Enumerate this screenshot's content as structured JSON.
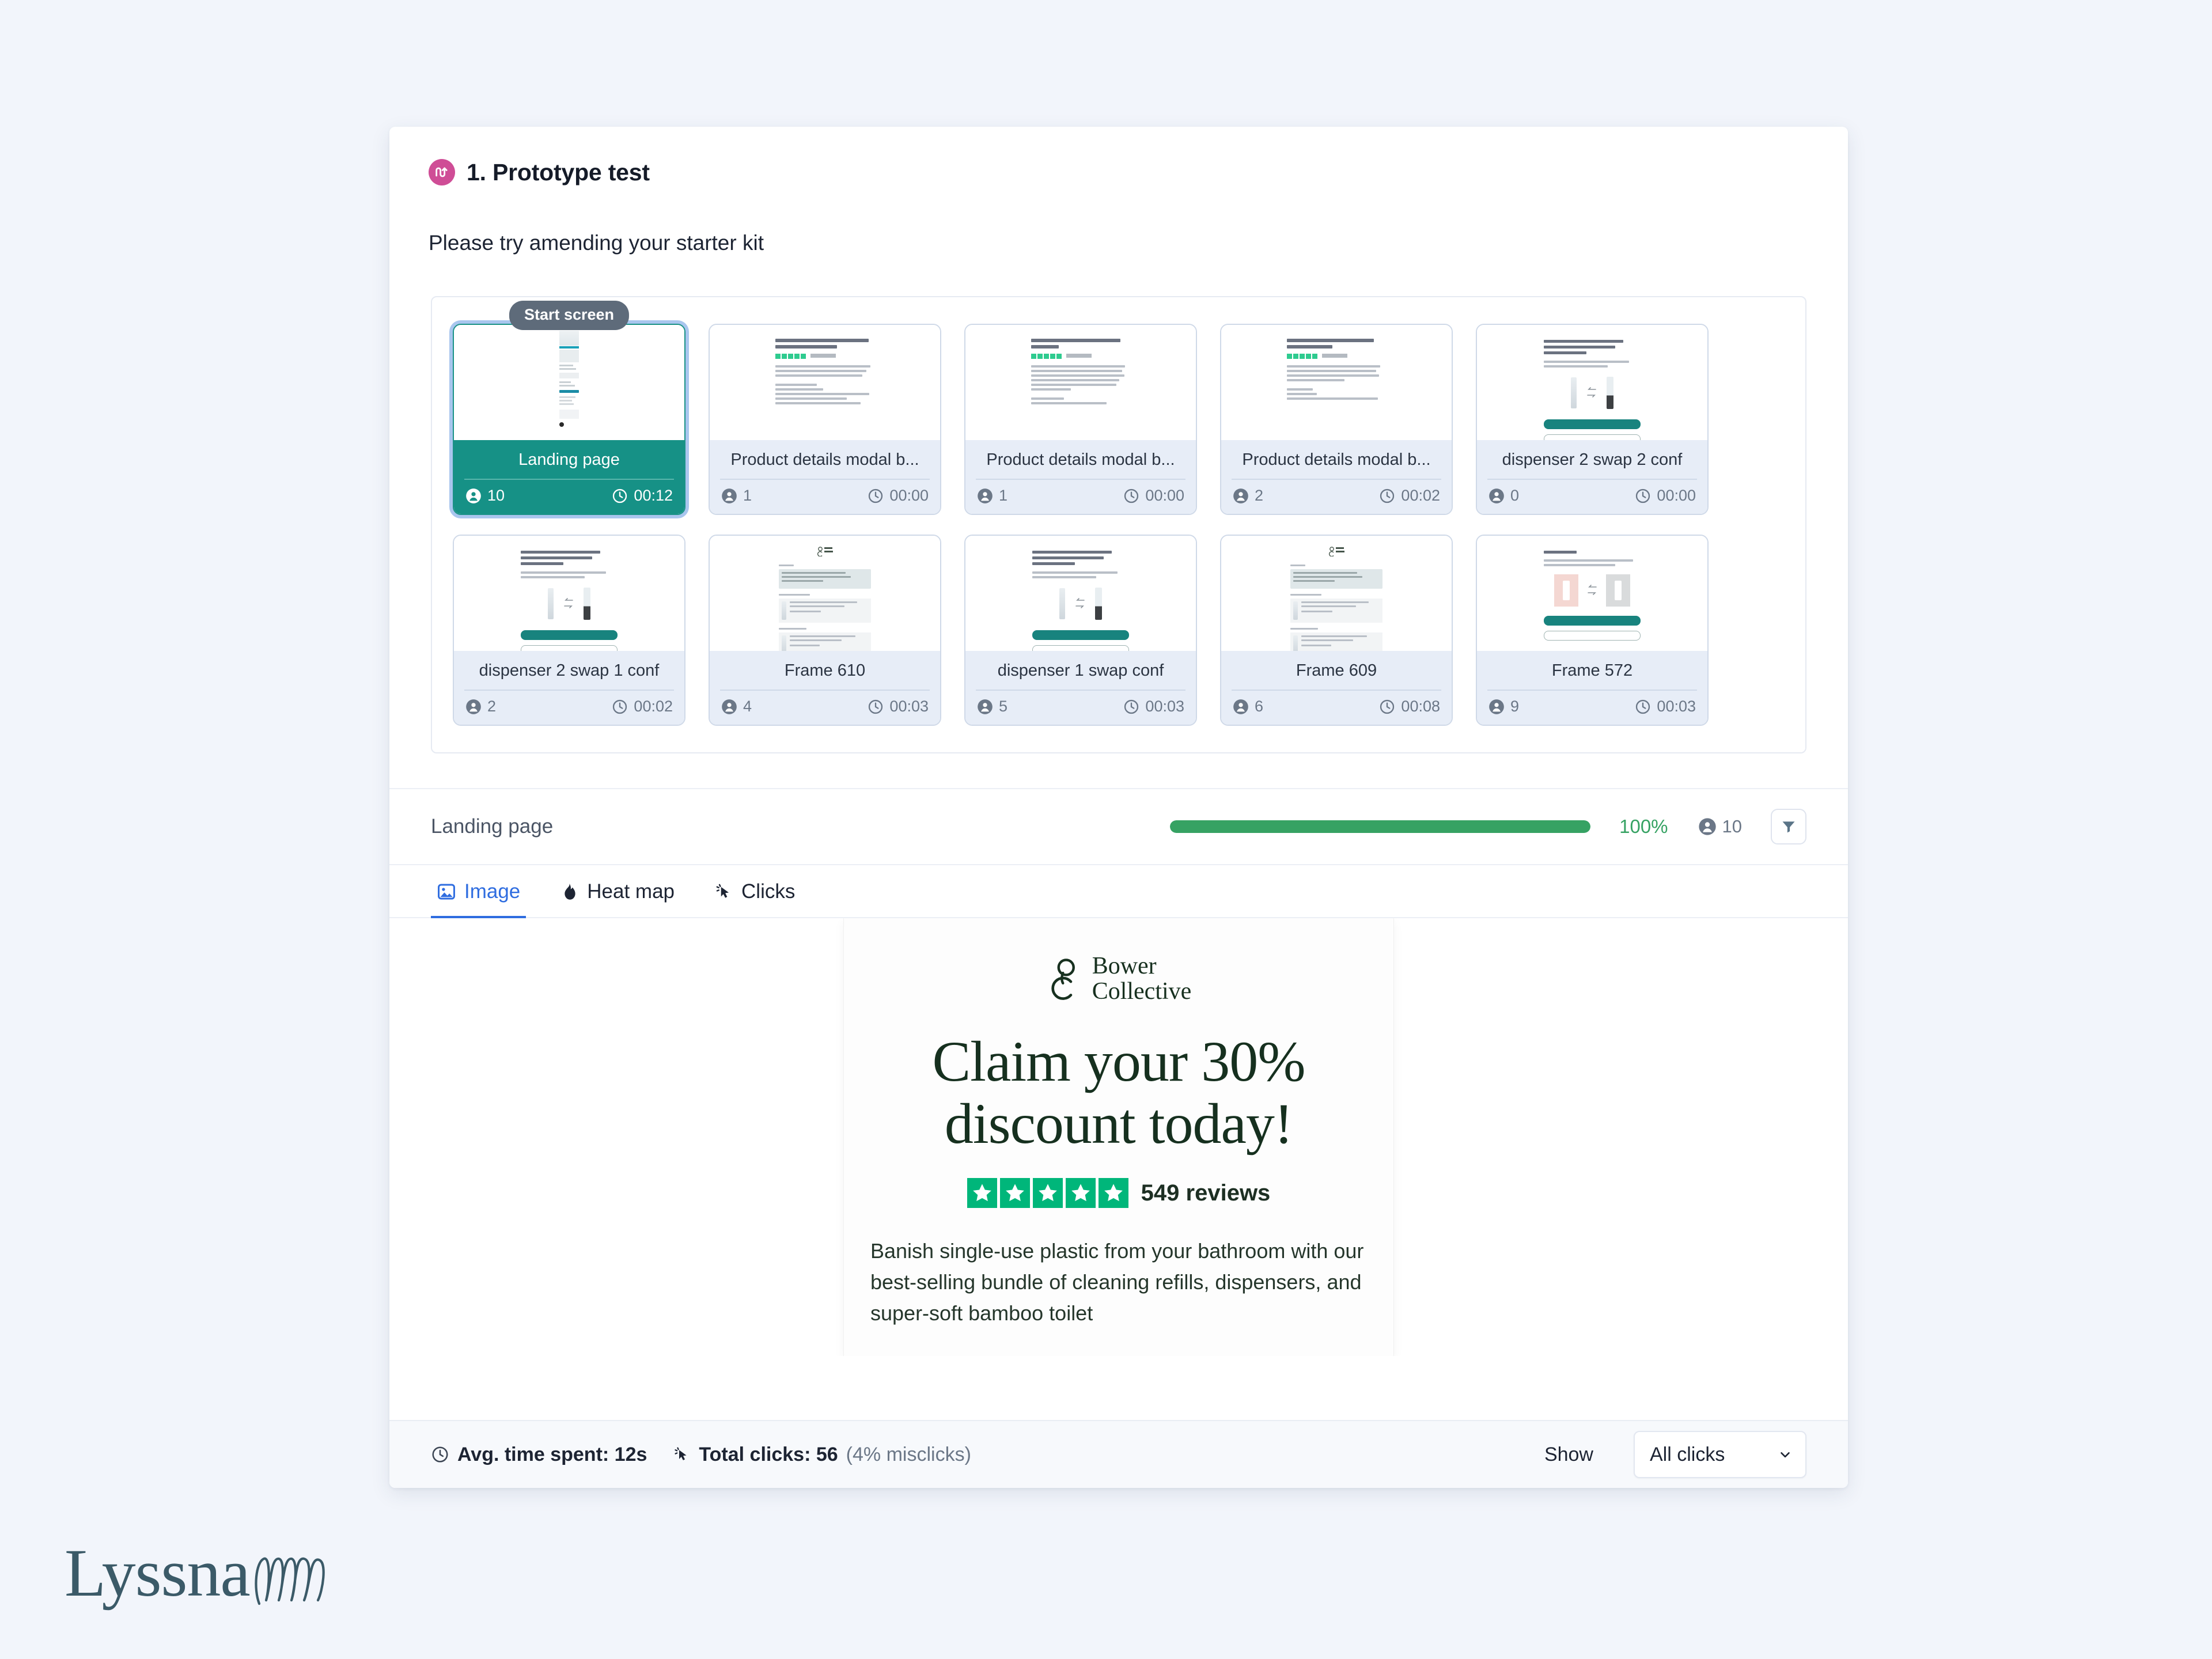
{
  "background_color": "#f2f5fb",
  "header": {
    "badge_icon": "prototype-flow-icon",
    "badge_color": "#cf4d96",
    "title": "1. Prototype test",
    "task_text": "Please try amending your starter kit"
  },
  "screens": {
    "start_pill_label": "Start screen",
    "items": [
      {
        "name": "Landing page",
        "participants": "10",
        "time": "00:12",
        "selected": true,
        "mock": "landing"
      },
      {
        "name": "Product details modal b...",
        "participants": "1",
        "time": "00:00",
        "selected": false,
        "mock": "product1"
      },
      {
        "name": "Product details modal b...",
        "participants": "1",
        "time": "00:00",
        "selected": false,
        "mock": "product2"
      },
      {
        "name": "Product details modal b...",
        "participants": "2",
        "time": "00:02",
        "selected": false,
        "mock": "product3"
      },
      {
        "name": "dispenser 2 swap 2 conf",
        "participants": "0",
        "time": "00:00",
        "selected": false,
        "mock": "swap"
      },
      {
        "name": "dispenser 2 swap 1 conf",
        "participants": "2",
        "time": "00:02",
        "selected": false,
        "mock": "swap"
      },
      {
        "name": "Frame 610",
        "participants": "4",
        "time": "00:03",
        "selected": false,
        "mock": "frame"
      },
      {
        "name": "dispenser 1 swap conf",
        "participants": "5",
        "time": "00:03",
        "selected": false,
        "mock": "swap"
      },
      {
        "name": "Frame 609",
        "participants": "6",
        "time": "00:08",
        "selected": false,
        "mock": "frame"
      },
      {
        "name": "Frame 572",
        "participants": "9",
        "time": "00:03",
        "selected": false,
        "mock": "swapcolor"
      }
    ]
  },
  "progress": {
    "label": "Landing page",
    "percent_label": "100%",
    "percent_value": 100,
    "participants": "10",
    "bar_color": "#36a263",
    "filter_icon": "filter-funnel-icon"
  },
  "tabs": [
    {
      "label": "Image",
      "icon": "image-icon",
      "active": true
    },
    {
      "label": "Heat map",
      "icon": "flame-icon",
      "active": false
    },
    {
      "label": "Clicks",
      "icon": "cursor-click-icon",
      "active": false
    }
  ],
  "preview": {
    "brand_line1": "Bower",
    "brand_line2": "Collective",
    "headline": "Claim your 30% discount today!",
    "reviews_count": "549 reviews",
    "stars": 5,
    "star_color": "#00b67a",
    "body": "Banish single-use plastic from your bathroom with our best-selling bundle of cleaning refills, dispensers, and super-soft bamboo toilet"
  },
  "footer": {
    "avg_time_label": "Avg. time spent: 12s",
    "avg_time_icon": "clock-icon",
    "total_clicks_strong": "Total clicks: 56",
    "total_clicks_muted": "(4% misclicks)",
    "clicks_icon": "cursor-click-icon",
    "show_label": "Show",
    "select_value": "All clicks",
    "select_icon": "chevron-down-icon"
  },
  "brand": {
    "logo_text": "Lyssna",
    "logo_color": "#3b5a68"
  }
}
